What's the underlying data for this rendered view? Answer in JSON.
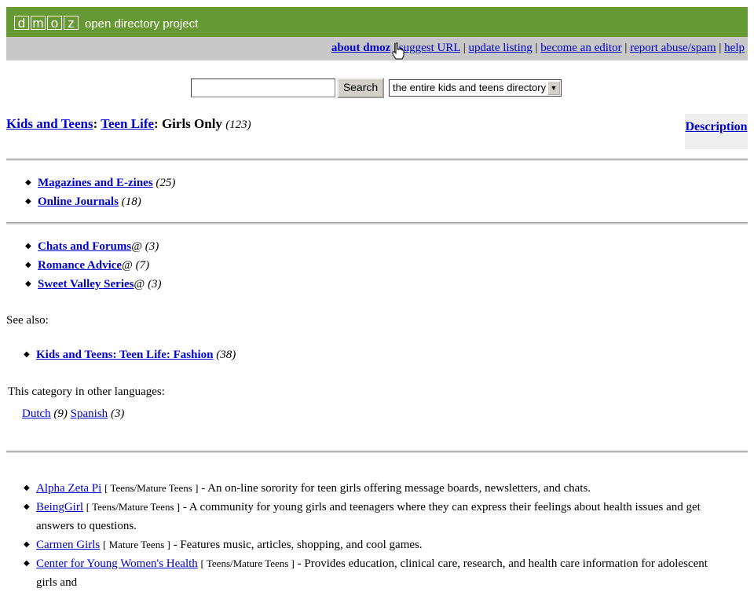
{
  "header": {
    "logo_letters": [
      "d",
      "m",
      "o",
      "z"
    ],
    "logo_text": "open directory project"
  },
  "nav": {
    "about": "about dmoz",
    "suggest": "suggest URL",
    "update": "update listing",
    "editor": "become an editor",
    "report": "report abuse/spam",
    "help": "help",
    "separator": "|"
  },
  "search": {
    "input_value": "",
    "button_label": "Search",
    "scope_selected": "the entire kids and teens directory"
  },
  "breadcrumb": {
    "level1": "Kids and Teens",
    "level2": "Teen Life",
    "current": "Girls Only",
    "count": "(123)",
    "sep": ":"
  },
  "description_link": "Description",
  "subcats_1": [
    {
      "label": "Magazines and E-zines",
      "count": "(25)"
    },
    {
      "label": "Online Journals",
      "count": "(18)"
    }
  ],
  "subcats_2": [
    {
      "label": "Chats and Forums",
      "at": "@",
      "count": "(3)"
    },
    {
      "label": "Romance Advice",
      "at": "@",
      "count": "(7)"
    },
    {
      "label": "Sweet Valley Series",
      "at": "@",
      "count": "(3)"
    }
  ],
  "see_also": {
    "heading": "See also:",
    "items": [
      {
        "label": "Kids and Teens: Teen Life: Fashion",
        "count": "(38)"
      }
    ]
  },
  "languages": {
    "heading": "This category in other languages:",
    "items": [
      {
        "label": "Dutch",
        "count": "(9)"
      },
      {
        "label": "Spanish",
        "count": "(3)"
      }
    ]
  },
  "sites": [
    {
      "title": "Alpha Zeta Pi",
      "tag": "[ Teens/Mature Teens ]",
      "desc": " - An on-line sorority for teen girls offering message boards, newsletters, and chats."
    },
    {
      "title": "BeingGirl",
      "tag": "[ Teens/Mature Teens ]",
      "desc": " - A community for young girls and teenagers where they can express their feelings about health issues and get answers to questions."
    },
    {
      "title": "Carmen Girls",
      "tag": "[ Mature Teens ]",
      "desc": " - Features music, articles, shopping, and cool games."
    },
    {
      "title": "Center for Young Women's Health",
      "tag": "[ Teens/Mature Teens ]",
      "desc": " - Provides education, clinical care, research, and health care information for adolescent girls and"
    }
  ],
  "colors": {
    "topbar": "#669933",
    "linkbar": "#c8c8c8",
    "link": "#0000cc"
  }
}
